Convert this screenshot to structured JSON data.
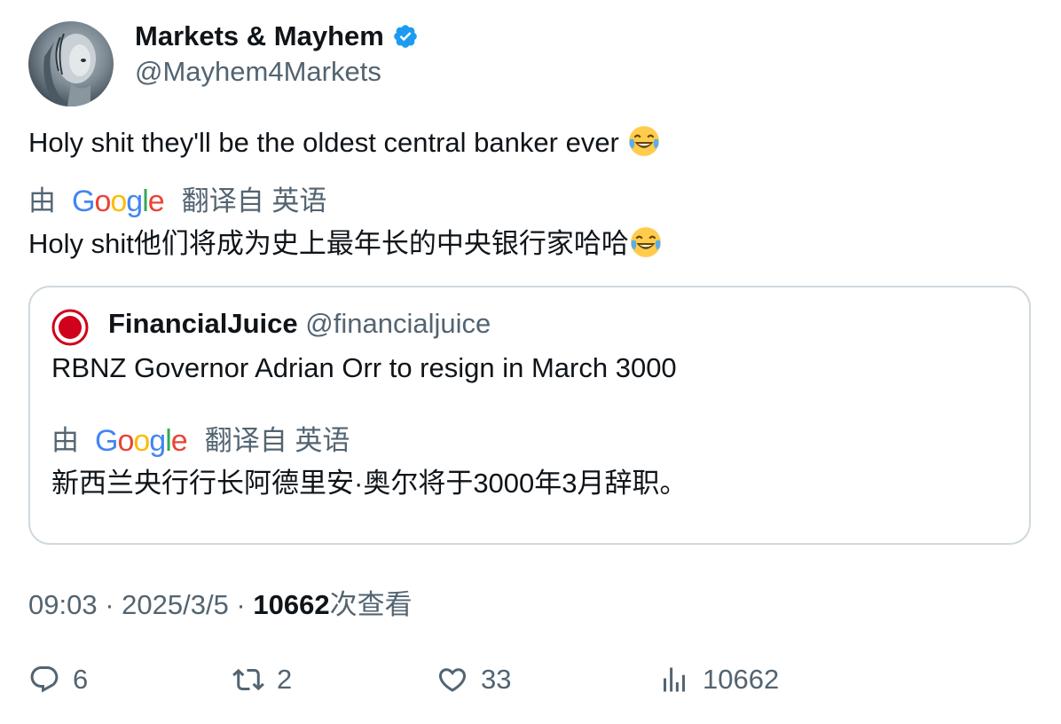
{
  "author": {
    "display_name": "Markets & Mayhem",
    "handle": "@Mayhem4Markets",
    "verified": true,
    "avatar_icon": "robot-avatar"
  },
  "tweet": {
    "text": "Holy shit they'll be the oldest central banker ever",
    "emoji": "face-with-tears-of-joy",
    "translation": {
      "prefix": "由",
      "provider": "Google",
      "suffix": "翻译自 英语",
      "text": "Holy shit他们将成为史上最年长的中央银行家哈哈"
    }
  },
  "quote": {
    "display_name": "FinancialJuice",
    "handle": "@financialjuice",
    "text": "RBNZ Governor Adrian Orr to resign in March 3000",
    "translation": {
      "prefix": "由",
      "provider": "Google",
      "suffix": "翻译自 英语",
      "text": "新西兰央行行长阿德里安·奥尔将于3000年3月辞职。"
    }
  },
  "meta": {
    "time": "09:03",
    "date": "2025/3/5",
    "views_count": "10662",
    "views_label": "次查看"
  },
  "actions": {
    "replies": "6",
    "retweets": "2",
    "likes": "33",
    "views": "10662"
  },
  "colors": {
    "text": "#0f1419",
    "secondary": "#536471",
    "verified": "#1d9bf0",
    "border": "#cfd9de",
    "quote_avatar": "#d0021b"
  }
}
